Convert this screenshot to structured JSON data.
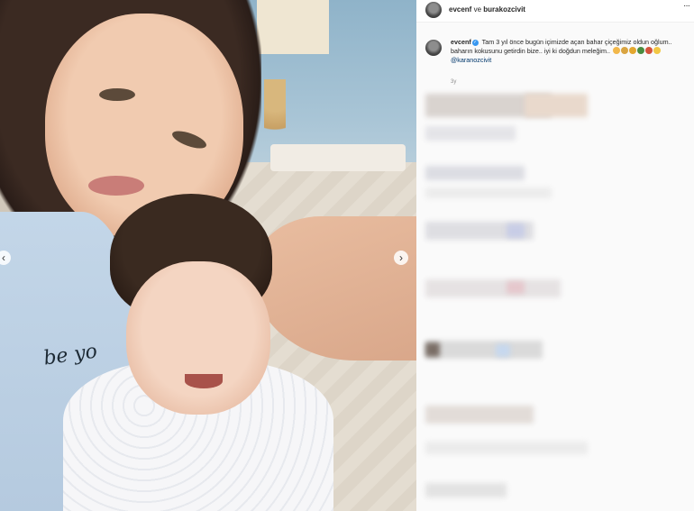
{
  "post": {
    "header": {
      "username": "evcenf",
      "separator": "ve",
      "collaborator": "burakozcivit",
      "more_icon": "more-horizontal-icon"
    },
    "photo": {
      "shirt_text": "be yo",
      "nav_left_icon": "chevron-left-icon",
      "nav_right_icon": "chevron-right-icon"
    },
    "caption": {
      "username": "evcenf",
      "verified_icon": "verified-badge-icon",
      "text": "Tam 3 yıl önce bugün içimizde açan bahar çiçeğimiz oldun oğlum.. baharın kokusunu getirdin bize.. iyi ki doğdun meleğim..",
      "emoji_colors": [
        "#f2b84b",
        "#d9a441",
        "#e3a72f",
        "#4a8b3f",
        "#d4533c",
        "#f2c744"
      ],
      "mention": "@karanozcivit",
      "timestamp": "3y"
    },
    "colors": {
      "accent_blue": "#3897f0",
      "mention": "#00376b",
      "text": "#262626",
      "muted": "#8e8e8e"
    }
  }
}
